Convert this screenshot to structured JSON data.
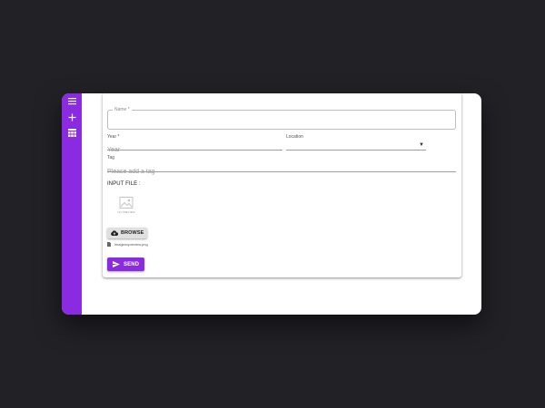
{
  "sidebar": {
    "icons": [
      "menu-icon",
      "plus-icon",
      "table-icon"
    ],
    "color": "#8a2be2"
  },
  "form": {
    "name_label": "Name *",
    "name_value": "",
    "year_label": "Year *",
    "year_placeholder": "Year",
    "location_label": "Location",
    "location_value": "",
    "tag_label": "Tag",
    "tag_placeholder": "Please add a tag",
    "input_file_title": "INPUT FILE :",
    "preview_text": "NO PREVIEW",
    "browse_label": "BROWSE",
    "file_name": "imagenopreview.png",
    "send_label": "SEND"
  },
  "colors": {
    "accent": "#8a2be2",
    "background": "#222126"
  }
}
